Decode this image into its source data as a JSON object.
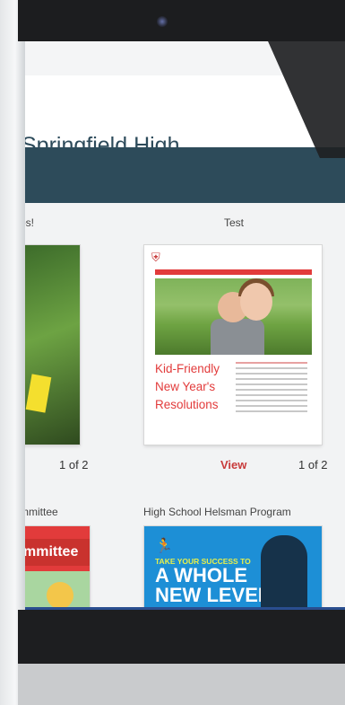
{
  "page": {
    "school_name": "Springfield High"
  },
  "sections": [
    {
      "title": "ps!",
      "pager": "1 of 2"
    },
    {
      "title": "Test",
      "view_label": "View",
      "pager": "1 of 2"
    }
  ],
  "row2": [
    {
      "title": "mmittee",
      "flyer_text": "mmittee"
    },
    {
      "title": "High School Helsman Program",
      "flyer_tag": "TAKE YOUR SUCCESS TO",
      "flyer_big": "A WHOLE\nNEW LEVEL"
    }
  ],
  "flyer": {
    "title": "Kid-Friendly\nNew Year's\nResolutions"
  },
  "colors": {
    "nav": "#2d4b5a",
    "accent": "#e23b3b"
  }
}
